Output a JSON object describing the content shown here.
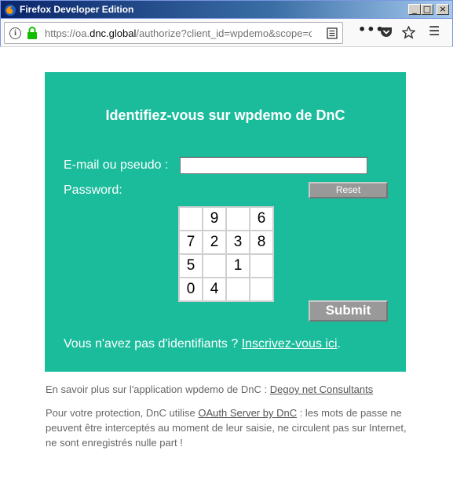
{
  "window": {
    "title": "Firefox Developer Edition",
    "min_label": "_",
    "max_label": "□",
    "close_label": "×"
  },
  "navbar": {
    "url_prefix": "https://oa.",
    "url_domain": "dnc.global",
    "url_rest": "/authorize?client_id=wpdemo&scope=o",
    "dots_label": "•••",
    "menu_label": "☰",
    "icons": [
      "info-icon",
      "lock-icon",
      "reader-view-icon",
      "page-actions-icon",
      "pocket-icon",
      "bookmark-star-icon",
      "hamburger-menu-icon"
    ]
  },
  "login": {
    "title": "Identifiez-vous sur wpdemo de DnC",
    "email_label": "E-mail ou pseudo :",
    "email_value": "",
    "password_label": "Password:",
    "reset_label": "Reset",
    "submit_label": "Submit",
    "keypad": [
      [
        "",
        "9",
        "",
        "6"
      ],
      [
        "7",
        "2",
        "3",
        "8"
      ],
      [
        "5",
        "",
        "1",
        ""
      ],
      [
        "0",
        "4",
        "",
        ""
      ]
    ],
    "no_account_text": "Vous n'avez pas d'identifiants ? ",
    "signup_link": "Inscrivez-vous ici",
    "signup_suffix": "."
  },
  "footer": {
    "about_text": "En savoir plus sur l'application wpdemo de DnC : ",
    "about_link": "Degoy net Consultants",
    "protection_prefix": "Pour votre protection, DnC utilise ",
    "protection_link": "OAuth Server by DnC",
    "protection_suffix": " : les mots de passe ne peuvent être interceptés au moment de leur saisie, ne circulent pas sur Internet, ne sont enregistrés nulle part !"
  },
  "colors": {
    "panel": "#1abc9c",
    "button": "#999999",
    "titlebar": "#0a246a"
  }
}
